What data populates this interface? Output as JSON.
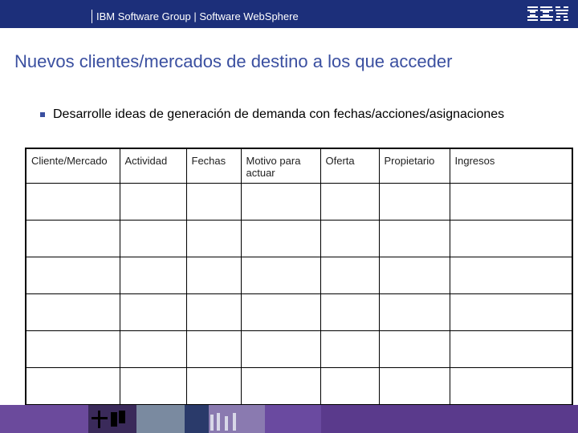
{
  "header": {
    "text": "IBM Software Group | Software WebSphere",
    "logo_text": "IBM"
  },
  "title": "Nuevos clientes/mercados de destino a los que acceder",
  "bullet": {
    "text": "Desarrolle ideas de generación de demanda con fechas/acciones/asignaciones"
  },
  "table": {
    "columns": [
      "Cliente/Mercado",
      "Actividad",
      "Fechas",
      "Motivo para actuar",
      "Oferta",
      "Propietario",
      "Ingresos"
    ],
    "rows": [
      [
        "",
        "",
        "",
        "",
        "",
        "",
        ""
      ],
      [
        "",
        "",
        "",
        "",
        "",
        "",
        ""
      ],
      [
        "",
        "",
        "",
        "",
        "",
        "",
        ""
      ],
      [
        "",
        "",
        "",
        "",
        "",
        "",
        ""
      ],
      [
        "",
        "",
        "",
        "",
        "",
        "",
        ""
      ],
      [
        "",
        "",
        "",
        "",
        "",
        "",
        ""
      ]
    ]
  },
  "colors": {
    "header_bg": "#1c2f7a",
    "title": "#3a4fa0",
    "footer_bg": "#5a3a8c"
  }
}
